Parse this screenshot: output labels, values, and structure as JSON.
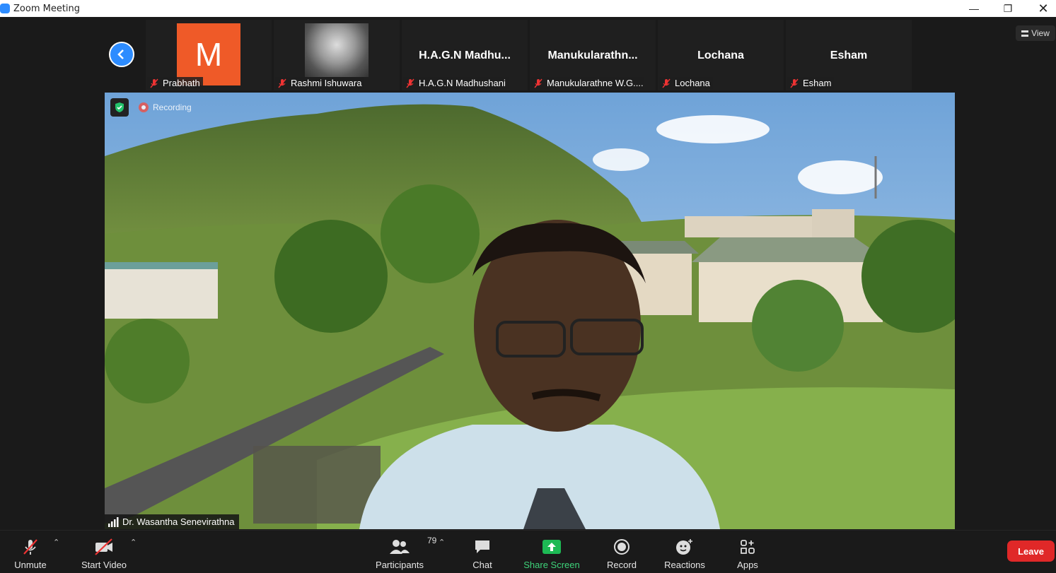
{
  "window": {
    "title": "Zoom Meeting"
  },
  "participants_strip": [
    {
      "display": "",
      "label": "Prabhath",
      "avatar_letter": "M"
    },
    {
      "display": "",
      "label": "Rashmi Ishuwara"
    },
    {
      "display": "H.A.G.N  Madhu...",
      "label": "H.A.G.N Madhushani"
    },
    {
      "display": "Manukularathn...",
      "label": "Manukularathne W.G...."
    },
    {
      "display": "Lochana",
      "label": "Lochana"
    },
    {
      "display": "Esham",
      "label": "Esham"
    }
  ],
  "view_button": {
    "label": "View"
  },
  "main": {
    "recording_label": "Recording",
    "speaker_name": "Dr. Wasantha Senevirathna"
  },
  "toolbar": {
    "unmute": "Unmute",
    "start_video": "Start Video",
    "participants": "Participants",
    "participant_count": "79",
    "chat": "Chat",
    "share_screen": "Share Screen",
    "record": "Record",
    "reactions": "Reactions",
    "apps": "Apps",
    "leave": "Leave"
  },
  "colors": {
    "accent_blue": "#2d8cff",
    "share_green": "#1db954",
    "leave_red": "#e02828",
    "avatar_orange": "#ef5a28"
  }
}
